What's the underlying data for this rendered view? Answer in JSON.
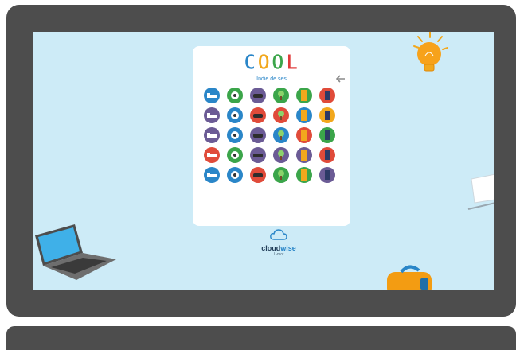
{
  "app": {
    "title": "COOL",
    "title_letters": [
      {
        "ch": "C",
        "color": "#2a86c8"
      },
      {
        "ch": "O",
        "color": "#f2a81d"
      },
      {
        "ch": "O",
        "color": "#3ba54a"
      },
      {
        "ch": "L",
        "color": "#e03a3a"
      }
    ],
    "subtitle": "Indie de ses"
  },
  "logo": {
    "brand_part1": "cloud",
    "brand_part2": "wise",
    "tagline": "L-mot"
  },
  "grid": {
    "tiles": [
      {
        "icon": "bed-icon",
        "color": "#2a86c8"
      },
      {
        "icon": "soccer-ball-icon",
        "color": "#3ba54a"
      },
      {
        "icon": "sofa-icon",
        "color": "#6b5b95"
      },
      {
        "icon": "tree-icon",
        "color": "#3ba54a"
      },
      {
        "icon": "door-icon",
        "color": "#3ba54a"
      },
      {
        "icon": "trousers-icon",
        "color": "#e04b3a"
      },
      {
        "icon": "cloud-icon",
        "color": "#6b5b95"
      },
      {
        "icon": "bicycle-icon",
        "color": "#2a86c8"
      },
      {
        "icon": "cup-icon",
        "color": "#e04b3a"
      },
      {
        "icon": "jacket-icon",
        "color": "#e04b3a"
      },
      {
        "icon": "house-icon",
        "color": "#2a86c8"
      },
      {
        "icon": "books-icon",
        "color": "#f2a81d"
      },
      {
        "icon": "moon-icon",
        "color": "#6b5b95"
      },
      {
        "icon": "guitar-icon",
        "color": "#2a86c8"
      },
      {
        "icon": "wardrobe-icon",
        "color": "#6b5b95"
      },
      {
        "icon": "bin-icon",
        "color": "#2a86c8"
      },
      {
        "icon": "brush-icon",
        "color": "#e04b3a"
      },
      {
        "icon": "shoe-icon",
        "color": "#3ba54a"
      },
      {
        "icon": "banana-icon",
        "color": "#e04b3a"
      },
      {
        "icon": "window-icon",
        "color": "#3ba54a"
      },
      {
        "icon": "car-icon",
        "color": "#6b5b95"
      },
      {
        "icon": "horse-icon",
        "color": "#6b5b95"
      },
      {
        "icon": "chair-icon",
        "color": "#6b5b95"
      },
      {
        "icon": "pen-icon",
        "color": "#e04b3a"
      },
      {
        "icon": "rocket-icon",
        "color": "#2a86c8"
      },
      {
        "icon": "fish-icon",
        "color": "#2a86c8"
      },
      {
        "icon": "skateboard-icon",
        "color": "#e04b3a"
      },
      {
        "icon": "sun-icon",
        "color": "#3ba54a"
      },
      {
        "icon": "microphone-icon",
        "color": "#3ba54a"
      },
      {
        "icon": "lamp-icon",
        "color": "#6b5b95"
      }
    ]
  }
}
